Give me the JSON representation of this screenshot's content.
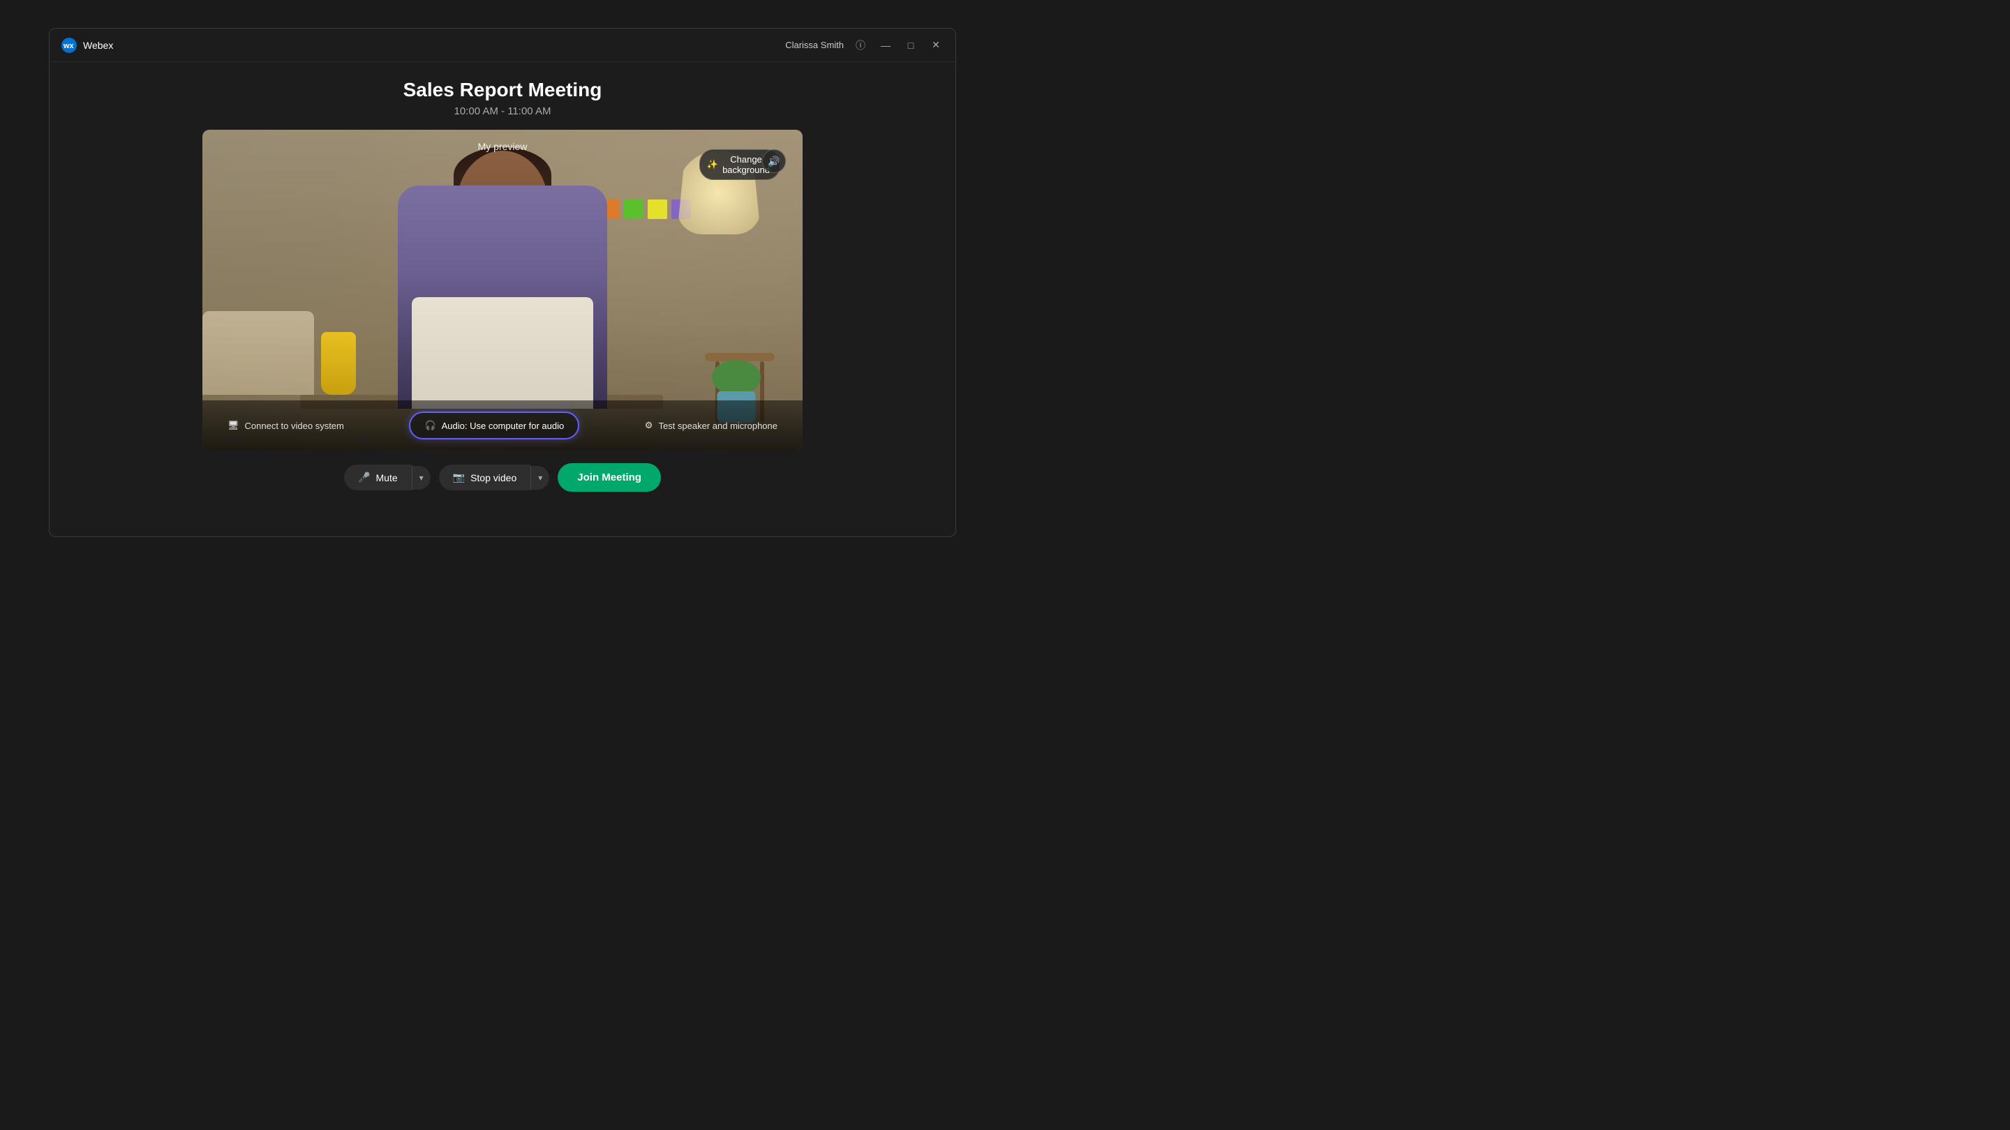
{
  "app": {
    "name": "Webex"
  },
  "titlebar": {
    "username": "Clarissa Smith",
    "minimize_label": "—",
    "maximize_label": "□",
    "close_label": "✕"
  },
  "meeting": {
    "title": "Sales Report Meeting",
    "time": "10:00 AM - 11:00 AM"
  },
  "preview": {
    "label": "My preview",
    "change_background": "Change background"
  },
  "controls": {
    "connect_video": "Connect to video system",
    "audio": "Audio: Use computer for audio",
    "test_speaker": "Test speaker and microphone",
    "mute": "Mute",
    "stop_video": "Stop video",
    "join_meeting": "Join Meeting"
  },
  "icons": {
    "webex_icon": "●",
    "info_icon": "ⓘ",
    "magic_icon": "✨",
    "speaker_icon": "🔊",
    "microphone_icon": "🎤",
    "camera_icon": "📷",
    "headset_icon": "🎧",
    "monitor_icon": "🖥",
    "gear_icon": "⚙"
  },
  "colors": {
    "accent_green": "#00a86b",
    "audio_border": "#6060ff",
    "bg_dark": "#1c1c1c"
  }
}
